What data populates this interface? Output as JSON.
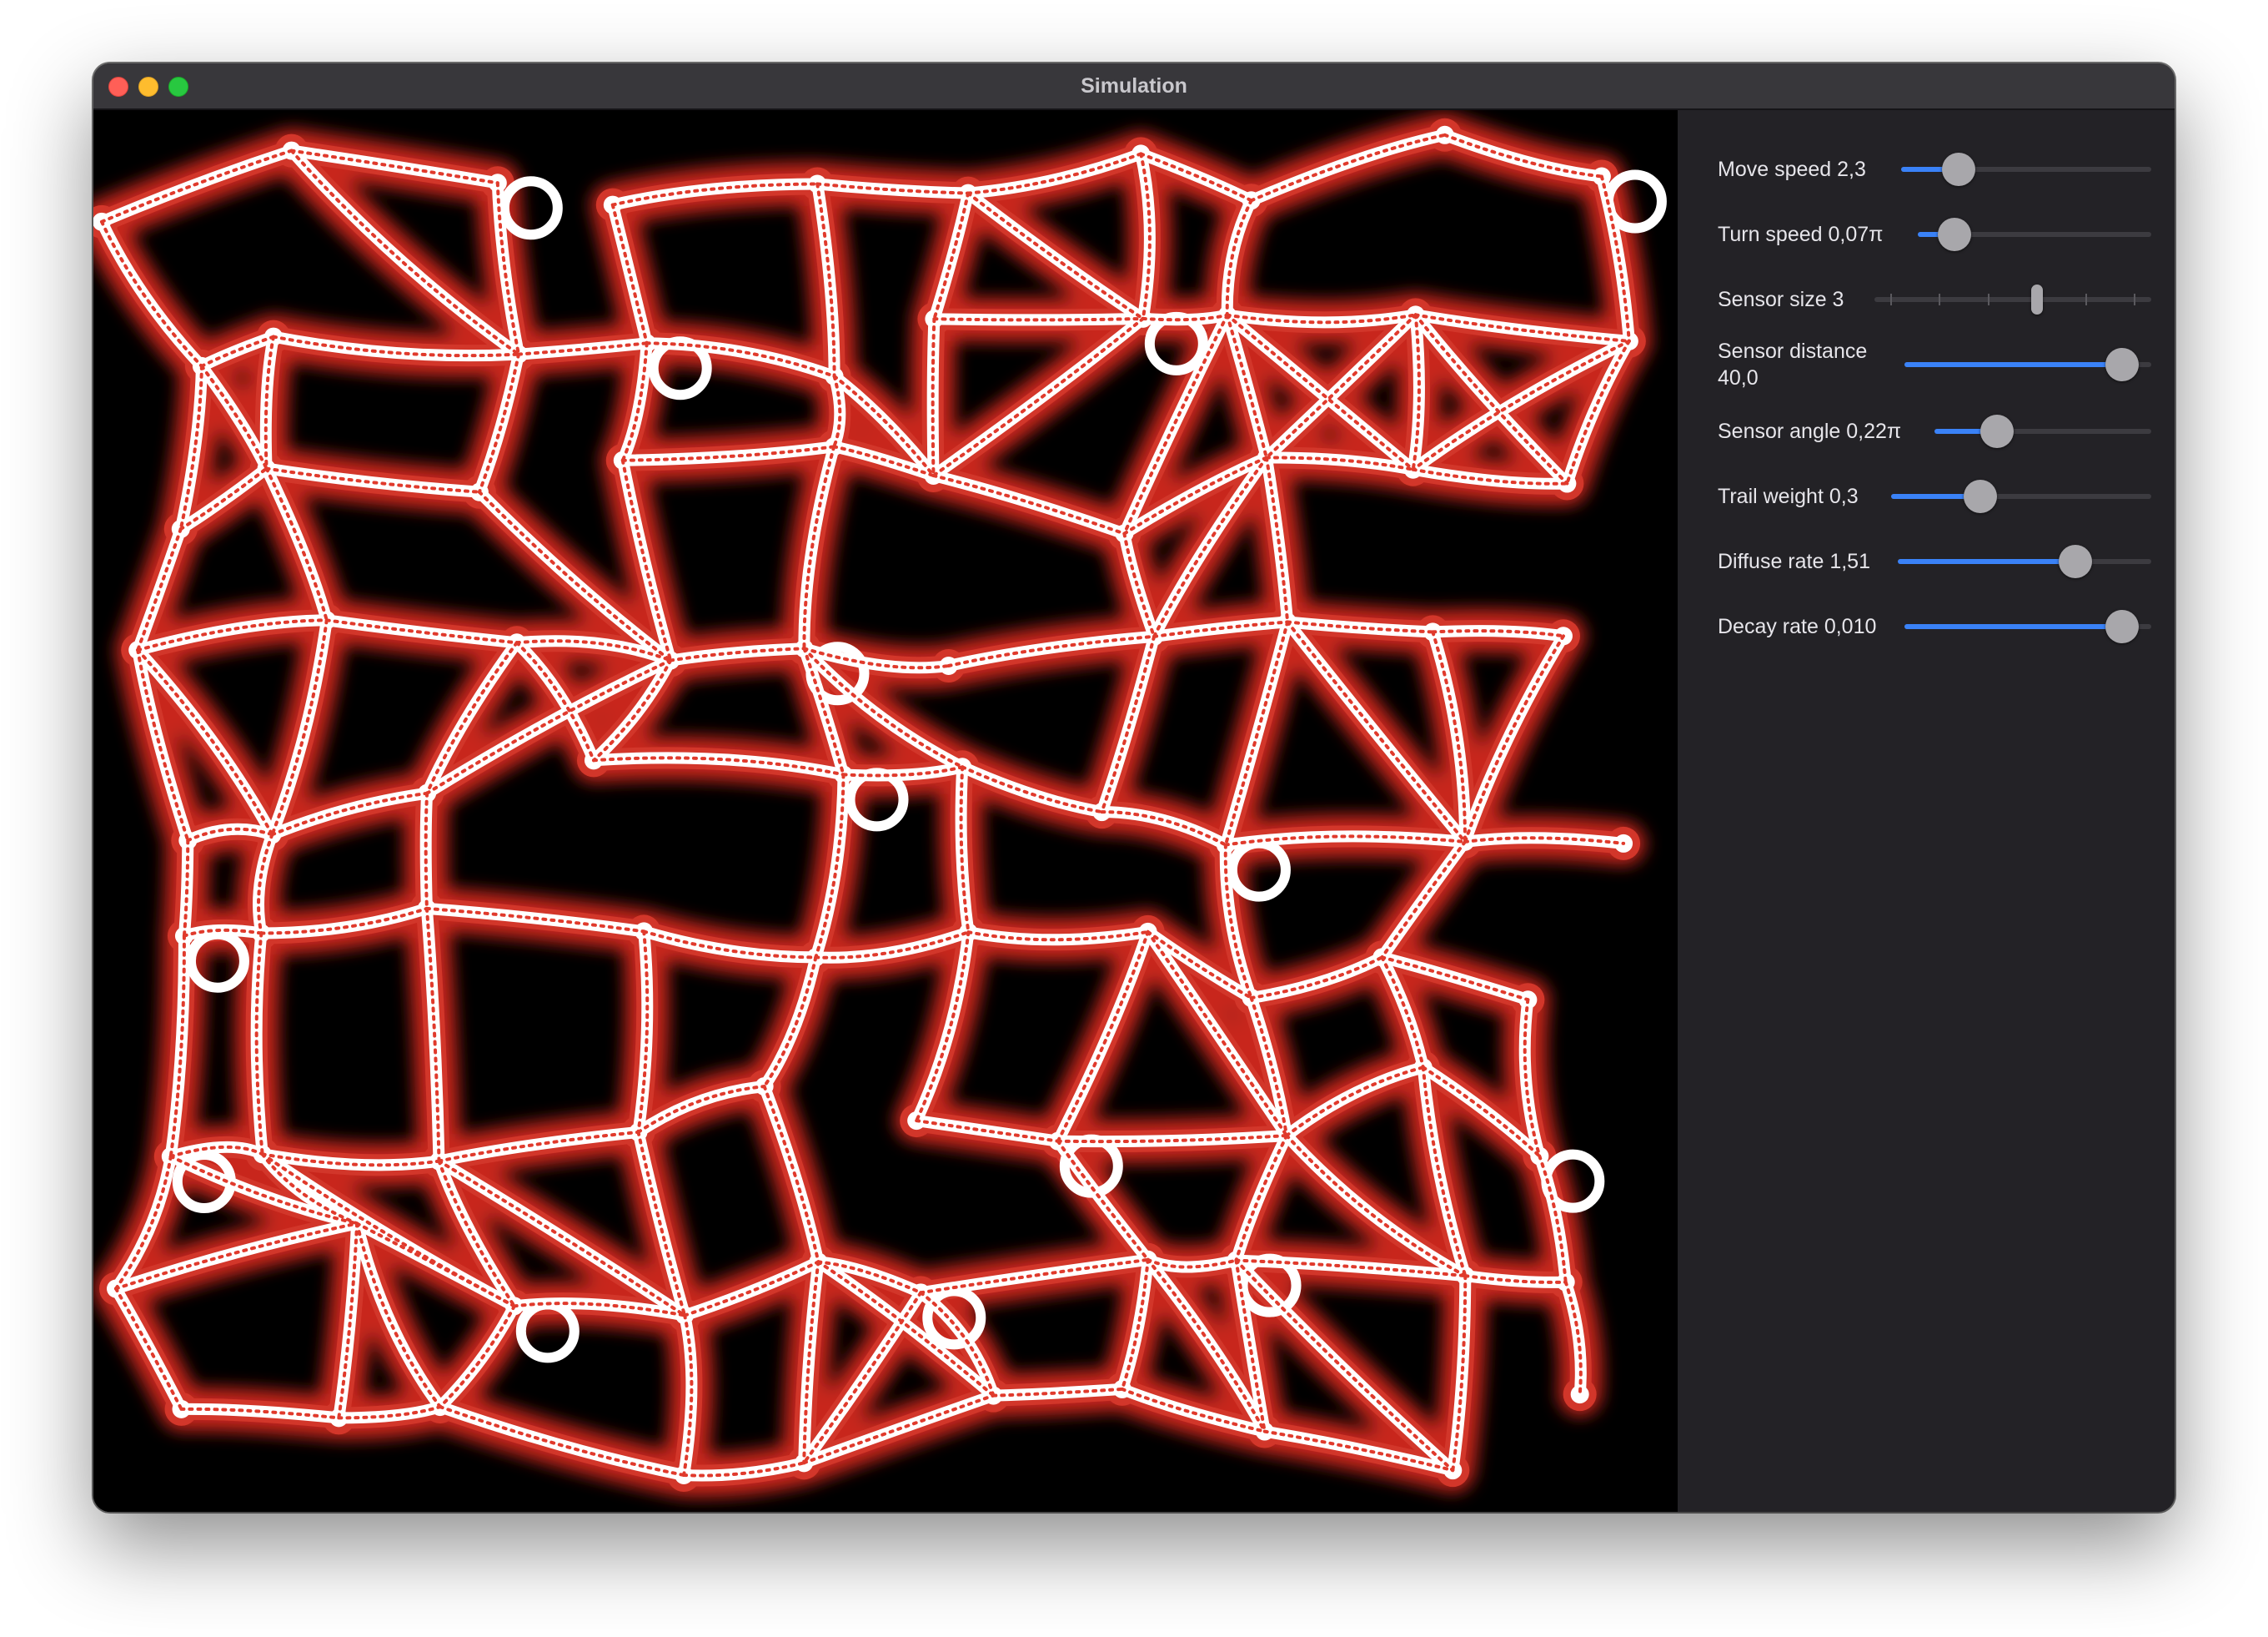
{
  "window": {
    "title": "Simulation"
  },
  "colors": {
    "accent": "#3a82f7",
    "trail_core": "#ffffff",
    "trail_glow": "#c8281e",
    "background": "#000000"
  },
  "controls": [
    {
      "id": "move-speed",
      "label": "Move speed 2,3",
      "value_fraction": 0.19
    },
    {
      "id": "turn-speed",
      "label": "Turn speed 0,07π",
      "value_fraction": 0.1
    },
    {
      "id": "sensor-size",
      "label": "Sensor size 3",
      "value_fraction": 0.6,
      "ticks": 6
    },
    {
      "id": "sensor-distance",
      "label": "Sensor distance 40,0",
      "value_fraction": 0.94
    },
    {
      "id": "sensor-angle",
      "label": "Sensor angle 0,22π",
      "value_fraction": 0.25
    },
    {
      "id": "trail-weight",
      "label": "Trail weight 0,3",
      "value_fraction": 0.32
    },
    {
      "id": "diffuse-rate",
      "label": "Diffuse rate 1,51",
      "value_fraction": 0.73
    },
    {
      "id": "decay-rate",
      "label": "Decay rate 0,010",
      "value_fraction": 0.94
    }
  ]
}
